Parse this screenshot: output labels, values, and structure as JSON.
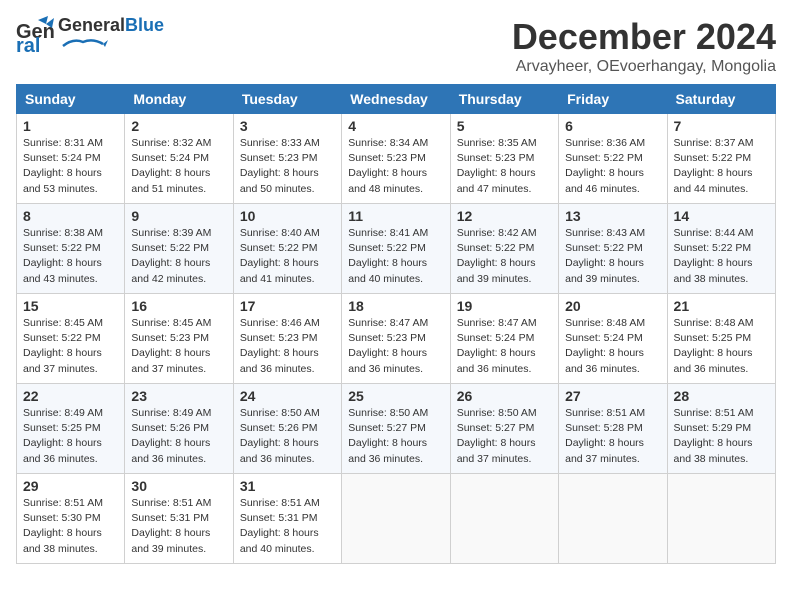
{
  "header": {
    "logo_general": "General",
    "logo_blue": "Blue",
    "title": "December 2024",
    "subtitle": "Arvayheer, OEvoerhangay, Mongolia"
  },
  "weekdays": [
    "Sunday",
    "Monday",
    "Tuesday",
    "Wednesday",
    "Thursday",
    "Friday",
    "Saturday"
  ],
  "weeks": [
    [
      {
        "day": "1",
        "sunrise": "Sunrise: 8:31 AM",
        "sunset": "Sunset: 5:24 PM",
        "daylight": "Daylight: 8 hours and 53 minutes."
      },
      {
        "day": "2",
        "sunrise": "Sunrise: 8:32 AM",
        "sunset": "Sunset: 5:24 PM",
        "daylight": "Daylight: 8 hours and 51 minutes."
      },
      {
        "day": "3",
        "sunrise": "Sunrise: 8:33 AM",
        "sunset": "Sunset: 5:23 PM",
        "daylight": "Daylight: 8 hours and 50 minutes."
      },
      {
        "day": "4",
        "sunrise": "Sunrise: 8:34 AM",
        "sunset": "Sunset: 5:23 PM",
        "daylight": "Daylight: 8 hours and 48 minutes."
      },
      {
        "day": "5",
        "sunrise": "Sunrise: 8:35 AM",
        "sunset": "Sunset: 5:23 PM",
        "daylight": "Daylight: 8 hours and 47 minutes."
      },
      {
        "day": "6",
        "sunrise": "Sunrise: 8:36 AM",
        "sunset": "Sunset: 5:22 PM",
        "daylight": "Daylight: 8 hours and 46 minutes."
      },
      {
        "day": "7",
        "sunrise": "Sunrise: 8:37 AM",
        "sunset": "Sunset: 5:22 PM",
        "daylight": "Daylight: 8 hours and 44 minutes."
      }
    ],
    [
      {
        "day": "8",
        "sunrise": "Sunrise: 8:38 AM",
        "sunset": "Sunset: 5:22 PM",
        "daylight": "Daylight: 8 hours and 43 minutes."
      },
      {
        "day": "9",
        "sunrise": "Sunrise: 8:39 AM",
        "sunset": "Sunset: 5:22 PM",
        "daylight": "Daylight: 8 hours and 42 minutes."
      },
      {
        "day": "10",
        "sunrise": "Sunrise: 8:40 AM",
        "sunset": "Sunset: 5:22 PM",
        "daylight": "Daylight: 8 hours and 41 minutes."
      },
      {
        "day": "11",
        "sunrise": "Sunrise: 8:41 AM",
        "sunset": "Sunset: 5:22 PM",
        "daylight": "Daylight: 8 hours and 40 minutes."
      },
      {
        "day": "12",
        "sunrise": "Sunrise: 8:42 AM",
        "sunset": "Sunset: 5:22 PM",
        "daylight": "Daylight: 8 hours and 39 minutes."
      },
      {
        "day": "13",
        "sunrise": "Sunrise: 8:43 AM",
        "sunset": "Sunset: 5:22 PM",
        "daylight": "Daylight: 8 hours and 39 minutes."
      },
      {
        "day": "14",
        "sunrise": "Sunrise: 8:44 AM",
        "sunset": "Sunset: 5:22 PM",
        "daylight": "Daylight: 8 hours and 38 minutes."
      }
    ],
    [
      {
        "day": "15",
        "sunrise": "Sunrise: 8:45 AM",
        "sunset": "Sunset: 5:22 PM",
        "daylight": "Daylight: 8 hours and 37 minutes."
      },
      {
        "day": "16",
        "sunrise": "Sunrise: 8:45 AM",
        "sunset": "Sunset: 5:23 PM",
        "daylight": "Daylight: 8 hours and 37 minutes."
      },
      {
        "day": "17",
        "sunrise": "Sunrise: 8:46 AM",
        "sunset": "Sunset: 5:23 PM",
        "daylight": "Daylight: 8 hours and 36 minutes."
      },
      {
        "day": "18",
        "sunrise": "Sunrise: 8:47 AM",
        "sunset": "Sunset: 5:23 PM",
        "daylight": "Daylight: 8 hours and 36 minutes."
      },
      {
        "day": "19",
        "sunrise": "Sunrise: 8:47 AM",
        "sunset": "Sunset: 5:24 PM",
        "daylight": "Daylight: 8 hours and 36 minutes."
      },
      {
        "day": "20",
        "sunrise": "Sunrise: 8:48 AM",
        "sunset": "Sunset: 5:24 PM",
        "daylight": "Daylight: 8 hours and 36 minutes."
      },
      {
        "day": "21",
        "sunrise": "Sunrise: 8:48 AM",
        "sunset": "Sunset: 5:25 PM",
        "daylight": "Daylight: 8 hours and 36 minutes."
      }
    ],
    [
      {
        "day": "22",
        "sunrise": "Sunrise: 8:49 AM",
        "sunset": "Sunset: 5:25 PM",
        "daylight": "Daylight: 8 hours and 36 minutes."
      },
      {
        "day": "23",
        "sunrise": "Sunrise: 8:49 AM",
        "sunset": "Sunset: 5:26 PM",
        "daylight": "Daylight: 8 hours and 36 minutes."
      },
      {
        "day": "24",
        "sunrise": "Sunrise: 8:50 AM",
        "sunset": "Sunset: 5:26 PM",
        "daylight": "Daylight: 8 hours and 36 minutes."
      },
      {
        "day": "25",
        "sunrise": "Sunrise: 8:50 AM",
        "sunset": "Sunset: 5:27 PM",
        "daylight": "Daylight: 8 hours and 36 minutes."
      },
      {
        "day": "26",
        "sunrise": "Sunrise: 8:50 AM",
        "sunset": "Sunset: 5:27 PM",
        "daylight": "Daylight: 8 hours and 37 minutes."
      },
      {
        "day": "27",
        "sunrise": "Sunrise: 8:51 AM",
        "sunset": "Sunset: 5:28 PM",
        "daylight": "Daylight: 8 hours and 37 minutes."
      },
      {
        "day": "28",
        "sunrise": "Sunrise: 8:51 AM",
        "sunset": "Sunset: 5:29 PM",
        "daylight": "Daylight: 8 hours and 38 minutes."
      }
    ],
    [
      {
        "day": "29",
        "sunrise": "Sunrise: 8:51 AM",
        "sunset": "Sunset: 5:30 PM",
        "daylight": "Daylight: 8 hours and 38 minutes."
      },
      {
        "day": "30",
        "sunrise": "Sunrise: 8:51 AM",
        "sunset": "Sunset: 5:31 PM",
        "daylight": "Daylight: 8 hours and 39 minutes."
      },
      {
        "day": "31",
        "sunrise": "Sunrise: 8:51 AM",
        "sunset": "Sunset: 5:31 PM",
        "daylight": "Daylight: 8 hours and 40 minutes."
      },
      null,
      null,
      null,
      null
    ]
  ]
}
